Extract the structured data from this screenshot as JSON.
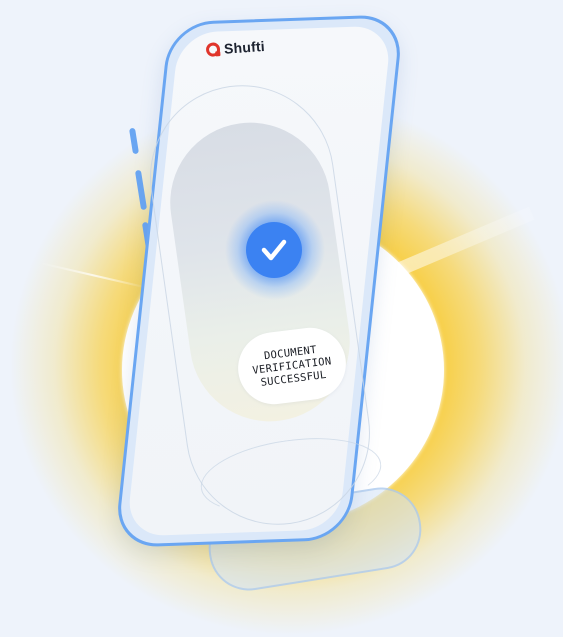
{
  "brand": {
    "name": "Shufti",
    "logo_icon": "shufti-logo-icon",
    "logo_color": "#e0352b"
  },
  "status": {
    "icon": "check-icon",
    "icon_color": "#3b82f2",
    "message_line1": "DOCUMENT",
    "message_line2": "VERIFICATION",
    "message_line3": "SUCCESSFUL"
  },
  "colors": {
    "glow": "#f6c52a",
    "phone_frame": "#6aa6f2",
    "background": "#eef3fb"
  }
}
